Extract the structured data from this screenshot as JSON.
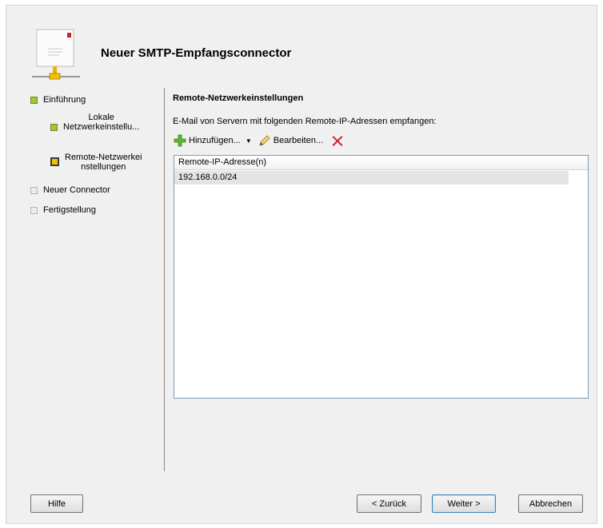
{
  "header": {
    "title": "Neuer SMTP-Empfangsconnector"
  },
  "nav": {
    "items": [
      {
        "label": "Einführung",
        "state": "done"
      },
      {
        "label": "Lokale Netzwerkeinstellu...",
        "line1": "Lokale",
        "line2": "Netzwerkeinstellu...",
        "state": "done"
      },
      {
        "label": "Remote-Netzwerkeinstellungen",
        "line1": "Remote-Netzwerkei",
        "line2": "nstellungen",
        "state": "active"
      },
      {
        "label": "Neuer Connector",
        "state": "pending"
      },
      {
        "label": "Fertigstellung",
        "state": "pending"
      }
    ]
  },
  "main": {
    "section_title": "Remote-Netzwerkeinstellungen",
    "description": "E-Mail von Servern mit folgenden Remote-IP-Adressen empfangen:",
    "toolbar": {
      "add_label": "Hinzufügen...",
      "edit_label": "Bearbeiten...",
      "add_icon": "green-plus-icon",
      "edit_icon": "pencil-icon",
      "delete_icon": "red-x-icon"
    },
    "list": {
      "column_header": "Remote-IP-Adresse(n)",
      "rows": [
        "192.168.0.0/24"
      ]
    }
  },
  "footer": {
    "help_label": "Hilfe",
    "back_label": "< Zurück",
    "next_label": "Weiter >",
    "cancel_label": "Abbrechen"
  },
  "colors": {
    "step_done": "#a4c73a",
    "step_active": "#f2c400",
    "list_border": "#7f9db9",
    "selected_row": "#e4e4e4"
  }
}
